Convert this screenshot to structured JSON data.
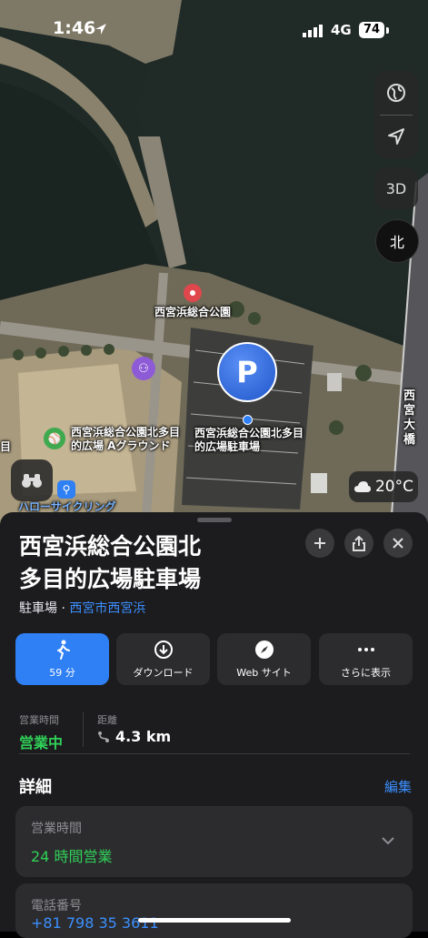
{
  "status_bar": {
    "time": "1:46",
    "network": "4G",
    "battery": "74"
  },
  "map": {
    "controls": {
      "three_d": "3D",
      "compass": "北"
    },
    "labels": {
      "park_poi": "西宮浜総合公園",
      "ground_poi": "西宮浜総合公園北多目的広場 Aグラウンド",
      "parking_poi": "西宮浜総合公園北多目的広場駐車場",
      "cycling_poi": "ハローサイクリング",
      "bridge": "西宮大橋",
      "parking_symbol": "P",
      "edge_letter": "目"
    },
    "weather": {
      "temperature": "20°C"
    }
  },
  "place": {
    "title_line1": "西宮浜総合公園北",
    "title_line2": "多目的広場駐車場",
    "category": "駐車場",
    "separator": "·",
    "locality": "西宮市西宮浜"
  },
  "actions": [
    {
      "label": "59 分",
      "icon": "walk-icon"
    },
    {
      "label": "ダウンロード",
      "icon": "download-icon"
    },
    {
      "label": "Web サイト",
      "icon": "compass-icon"
    },
    {
      "label": "さらに表示",
      "icon": "more-icon"
    }
  ],
  "summary": {
    "hours_label": "営業時間",
    "hours_value": "営業中",
    "distance_label": "距離",
    "distance_value": "4.3 km"
  },
  "details": {
    "title": "詳細",
    "edit": "編集",
    "hours_label": "営業時間",
    "hours_value": "24 時間営業",
    "phone_label": "電話番号",
    "phone_value": "+81 798 35 3611"
  },
  "colors": {
    "accent": "#2f7ff5",
    "open": "#30d158",
    "link": "#3b8fff",
    "sheet": "#1c1c1e"
  }
}
